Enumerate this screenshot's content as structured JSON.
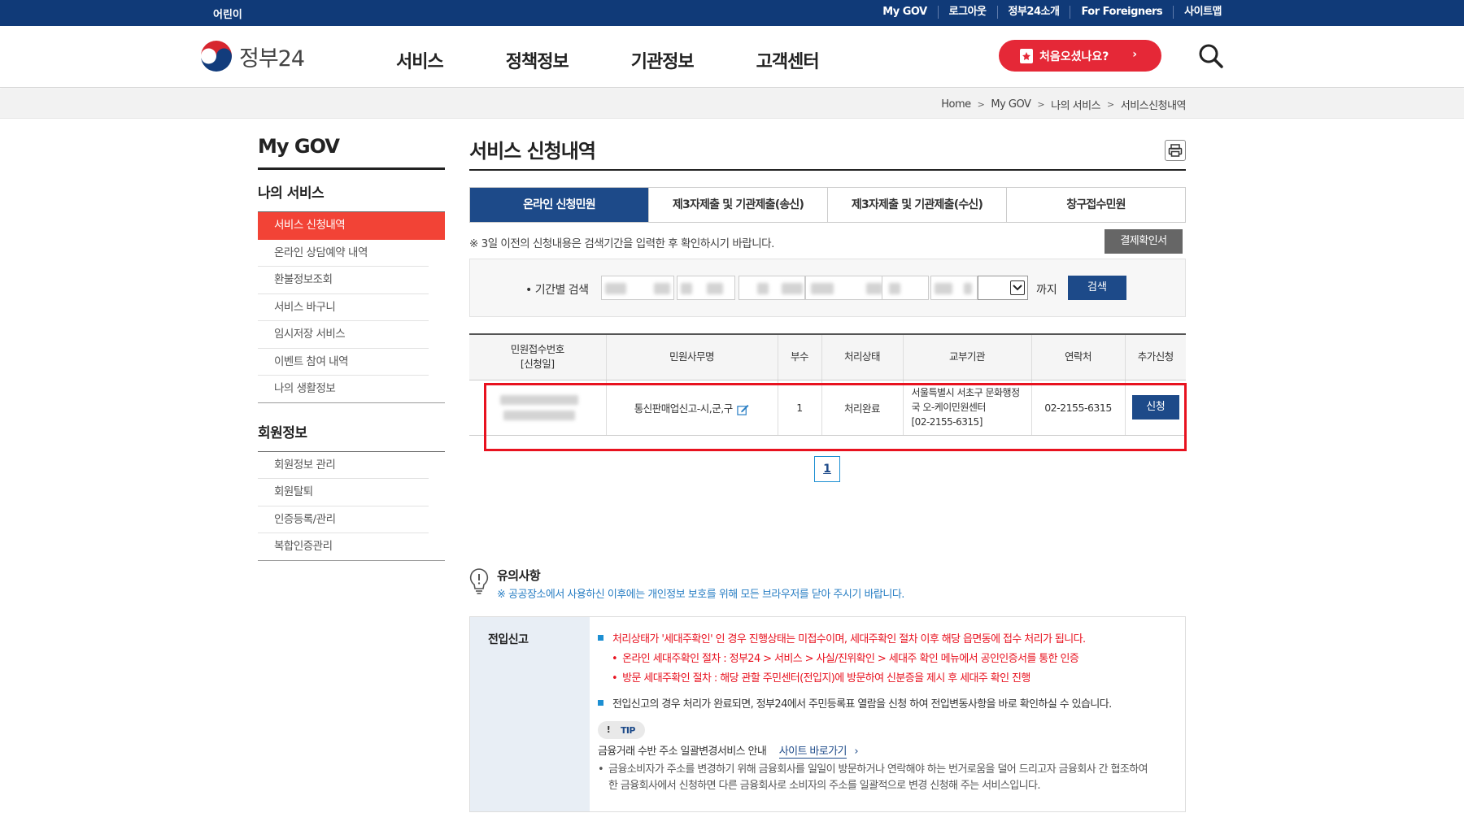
{
  "topbar": {
    "kids": "어린이",
    "links": [
      "My GOV",
      "로그아웃",
      "정부24소개",
      "For Foreigners",
      "사이트맵"
    ]
  },
  "header": {
    "logo_text": "정부24",
    "nav": [
      "서비스",
      "정책정보",
      "기관정보",
      "고객센터"
    ],
    "first_visit": "처음오셨나요?",
    "first_visit_chevron": "›"
  },
  "breadcrumb": [
    "Home",
    "My GOV",
    "나의 서비스",
    "서비스신청내역"
  ],
  "sidebar": {
    "title": "My GOV",
    "group1": "나의 서비스",
    "items1": [
      "서비스 신청내역",
      "온라인 상담예약 내역",
      "환불정보조회",
      "서비스 바구니",
      "임시저장 서비스",
      "이벤트 참여 내역",
      "나의 생활정보"
    ],
    "group2": "회원정보",
    "items2": [
      "회원정보 관리",
      "회원탈퇴",
      "인증등록/관리",
      "복합인증관리"
    ]
  },
  "main": {
    "title": "서비스 신청내역",
    "tabs": [
      "온라인 신청민원",
      "제3자제출 및 기관제출(송신)",
      "제3자제출 및 기관제출(수신)",
      "창구접수민원"
    ],
    "notice": "※ 3일 이전의 신청내용은 검색기간을 입력한 후 확인하시기 바랍니다.",
    "pay_button": "결제확인서",
    "search": {
      "label": "• 기간별 검색",
      "until": "까지",
      "button": "검색"
    },
    "table": {
      "headers": [
        "민원접수번호\n[신청일]",
        "민원사무명",
        "부수",
        "처리상태",
        "교부기관",
        "연락처",
        "추가신청"
      ],
      "row": {
        "service": "통신판매업신고-시,군,구",
        "copies": "1",
        "status": "처리완료",
        "org_line1": "서울특별시 서초구 문화행정",
        "org_line2": "국 오-케이민원센터",
        "org_line3": "[02-2155-6315]",
        "contact": "02-2155-6315",
        "apply": "신청"
      }
    },
    "pagination": [
      "1"
    ]
  },
  "caution": {
    "title": "유의사항",
    "text": "※ 공공장소에서 사용하신 이후에는 개인정보 보호를 위해 모든 브라우저를 닫아 주시기 바랍니다."
  },
  "info": {
    "head": "전입신고",
    "line1": "처리상태가 '세대주확인' 인 경우 진행상태는 미접수이며, 세대주확인 절차 이후 해당 읍면동에 접수 처리가 됩니다.",
    "line1a": "온라인 세대주확인 절차 : 정부24 > 서비스 > 사실/진위확인 > 세대주 확인 메뉴에서 공인인증서를 통한 인증",
    "line1b": "방문 세대주확인 절차 : 해당 관할 주민센터(전입지)에 방문하여 신분증을 제시 후 세대주 확인 진행",
    "line2": "전입신고의 경우 처리가 완료되면, 정부24에서 주민등록표 열람을 신청 하여 전입변동사항을 바로 확인하실 수 있습니다.",
    "tip": "TIP",
    "tip_bang": "!",
    "finance": "금융거래 수반 주소 일괄변경서비스 안내",
    "site_link": "사이트 바로가기",
    "site_chevron": "›",
    "desc1": "금융소비자가 주소를 변경하기 위해 금융회사를 일일이 방문하거나 연락해야 하는 번거로움을 덜어 드리고자 금융회사 간 협조하여",
    "desc2": "한 금융회사에서 신청하면 다른 금융회사로 소비자의 주소를 일괄적으로 변경 신청해 주는 서비스입니다."
  },
  "colors": {
    "topbar": "#103a78",
    "primary": "#1d4a89",
    "accent_red": "#e52837",
    "highlight": "#e8121f",
    "active_side": "#f24336"
  }
}
